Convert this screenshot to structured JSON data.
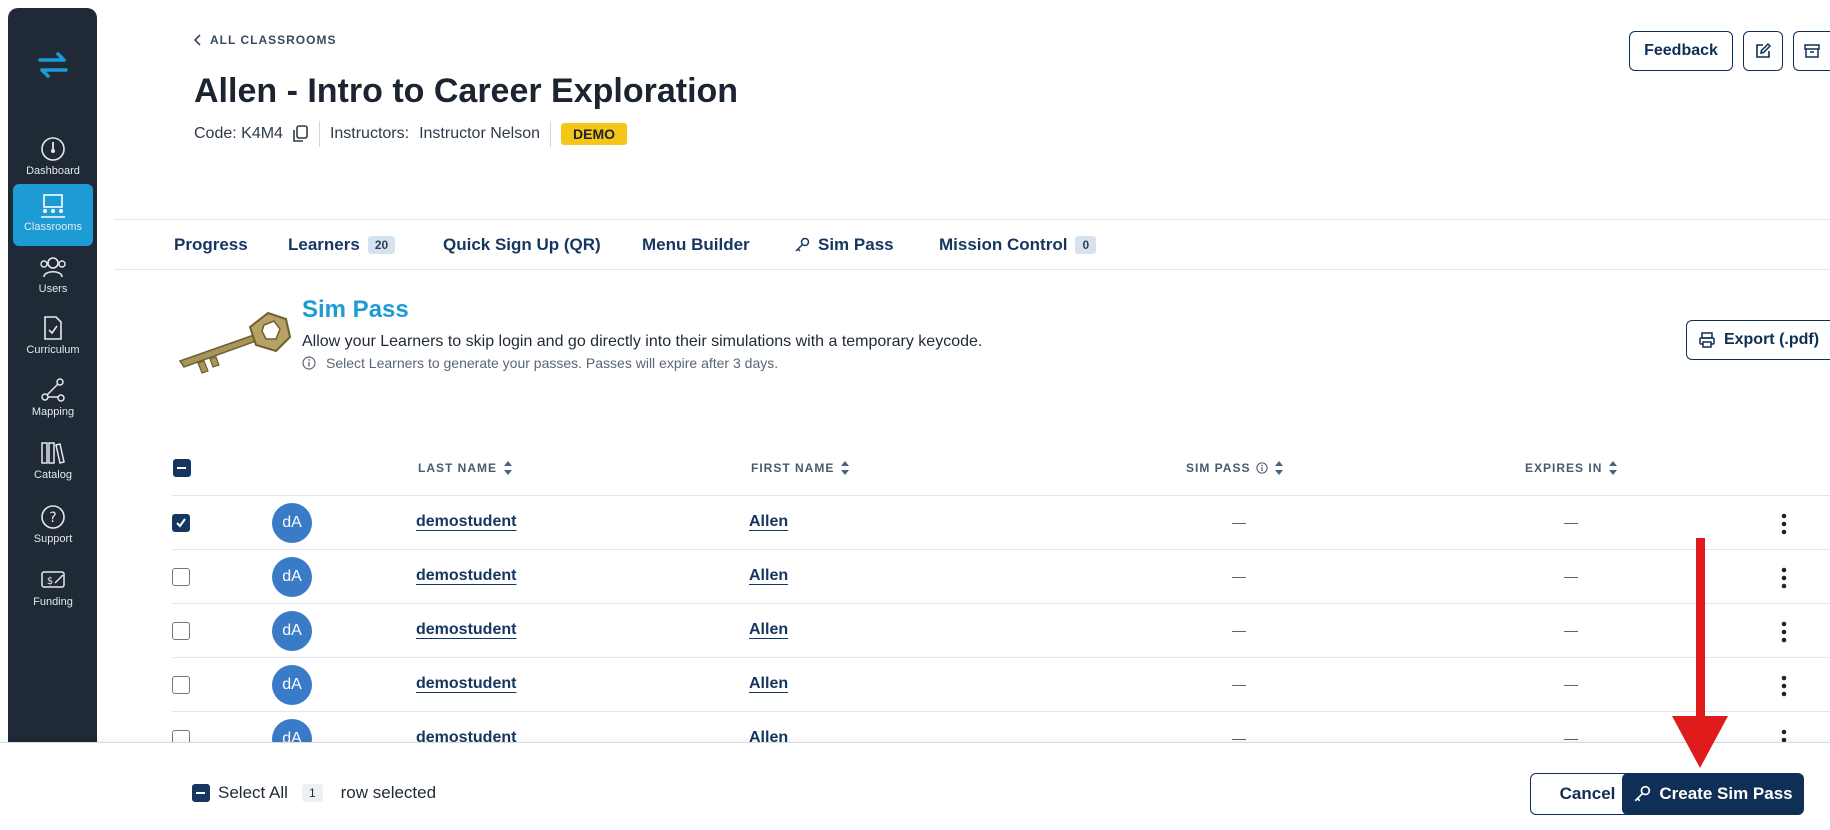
{
  "sidebar": {
    "items": [
      {
        "label": "Dashboard",
        "icon": "dashboard-icon"
      },
      {
        "label": "Classrooms",
        "icon": "classrooms-icon",
        "active": true
      },
      {
        "label": "Users",
        "icon": "users-icon"
      },
      {
        "label": "Curriculum",
        "icon": "curriculum-icon"
      },
      {
        "label": "Mapping",
        "icon": "mapping-icon"
      },
      {
        "label": "Catalog",
        "icon": "catalog-icon"
      },
      {
        "label": "Support",
        "icon": "support-icon"
      },
      {
        "label": "Funding",
        "icon": "funding-icon"
      }
    ]
  },
  "header": {
    "breadcrumb": "ALL CLASSROOMS",
    "title": "Allen - Intro to Career Exploration",
    "code_label": "Code: K4M4",
    "instructors_label": "Instructors:",
    "instructor_name": "Instructor Nelson",
    "badge": "DEMO",
    "feedback_label": "Feedback"
  },
  "tabs": [
    {
      "label": "Progress"
    },
    {
      "label": "Learners",
      "count": "20"
    },
    {
      "label": "Quick Sign Up (QR)"
    },
    {
      "label": "Menu Builder"
    },
    {
      "label": "Sim Pass",
      "icon": "key-icon"
    },
    {
      "label": "Mission Control",
      "count": "0"
    }
  ],
  "sim_pass": {
    "title": "Sim Pass",
    "description": "Allow your Learners to skip login and go directly into their simulations with a temporary keycode.",
    "hint": "Select Learners to generate your passes. Passes will expire after 3 days.",
    "export_label": "Export (.pdf)"
  },
  "table": {
    "columns": {
      "last_name": "LAST NAME",
      "first_name": "FIRST NAME",
      "sim_pass": "SIM PASS",
      "expires_in": "EXPIRES IN"
    },
    "rows": [
      {
        "initials": "dA",
        "last_name": "demostudent",
        "first_name": "Allen",
        "sim_pass": "—",
        "expires_in": "—",
        "checked": true
      },
      {
        "initials": "dA",
        "last_name": "demostudent",
        "first_name": "Allen",
        "sim_pass": "—",
        "expires_in": "—",
        "checked": false
      },
      {
        "initials": "dA",
        "last_name": "demostudent",
        "first_name": "Allen",
        "sim_pass": "—",
        "expires_in": "—",
        "checked": false
      },
      {
        "initials": "dA",
        "last_name": "demostudent",
        "first_name": "Allen",
        "sim_pass": "—",
        "expires_in": "—",
        "checked": false
      },
      {
        "initials": "dA",
        "last_name": "demostudent",
        "first_name": "Allen",
        "sim_pass": "—",
        "expires_in": "—",
        "checked": false
      }
    ]
  },
  "footer": {
    "select_all_label": "Select All",
    "selected_count": "1",
    "selected_suffix": "row selected",
    "cancel_label": "Cancel",
    "create_label": "Create Sim Pass"
  },
  "colors": {
    "sidebar_bg": "#1f2a36",
    "accent": "#1d9bd5",
    "navy": "#0f2f56",
    "demo_badge": "#f5c518",
    "avatar": "#3a7bc8",
    "annotation_arrow": "#e01b1b"
  }
}
